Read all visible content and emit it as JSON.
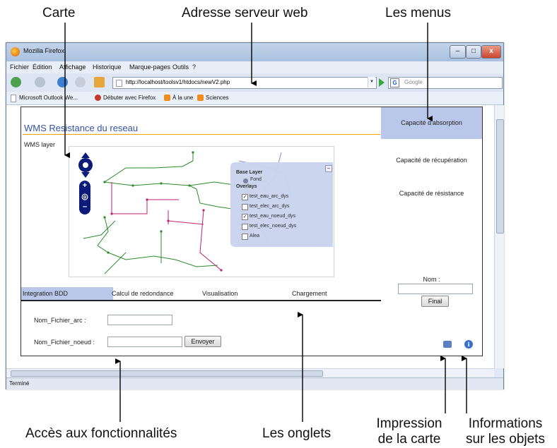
{
  "annotations": {
    "carte": "Carte",
    "adresse": "Adresse serveur web",
    "menus": "Les menus",
    "acces": "Accès aux fonctionnalités",
    "onglets": "Les onglets",
    "impression_l1": "Impression",
    "impression_l2": "de la carte",
    "informations_l1": "Informations",
    "informations_l2": "sur les objets"
  },
  "browser": {
    "title": "Mozilla Firefox",
    "menu": [
      "Fichier",
      "Édition",
      "Affichage",
      "Historique",
      "Marque-pages",
      "Outils",
      "?"
    ],
    "url": "http://localhost/toolsv1/htdocs/newV2.php",
    "search_placeholder": "Google",
    "bookmarks": [
      "Microsoft Outlook We...",
      "Débuter avec Firefox",
      "À la une",
      "Sciences"
    ],
    "status": "Terminé",
    "window_buttons": {
      "minimize": "–",
      "maximize": "□",
      "close": "x"
    }
  },
  "app": {
    "title": "WMS Resistance du reseau",
    "layer_label": "WMS layer",
    "layer_switcher": {
      "base_title": "Base Layer",
      "base_layers": [
        "Fond"
      ],
      "overlays_title": "Overlays",
      "overlays": [
        {
          "label": "test_eau_arc_dys",
          "checked": true
        },
        {
          "label": "test_elec_arc_dys",
          "checked": false
        },
        {
          "label": "test_eau_noeud_dys",
          "checked": true
        },
        {
          "label": "test_elec_noeud_dys",
          "checked": false
        },
        {
          "label": "Alea",
          "checked": false
        }
      ]
    },
    "tabs": [
      "Integration BDD",
      "Calcul de redondance",
      "Visualisation",
      "Chargement"
    ],
    "form": {
      "arc_label": "Nom_Fichier_arc :",
      "noeud_label": "Nom_Fichier_noeud :",
      "send_button": "Envoyer"
    },
    "right_menu": {
      "items": [
        "Capacité d'absorption",
        "Capacité de récupération",
        "Capacité de résistance"
      ],
      "nom_label": "Nom :",
      "final_button": "Final"
    }
  }
}
